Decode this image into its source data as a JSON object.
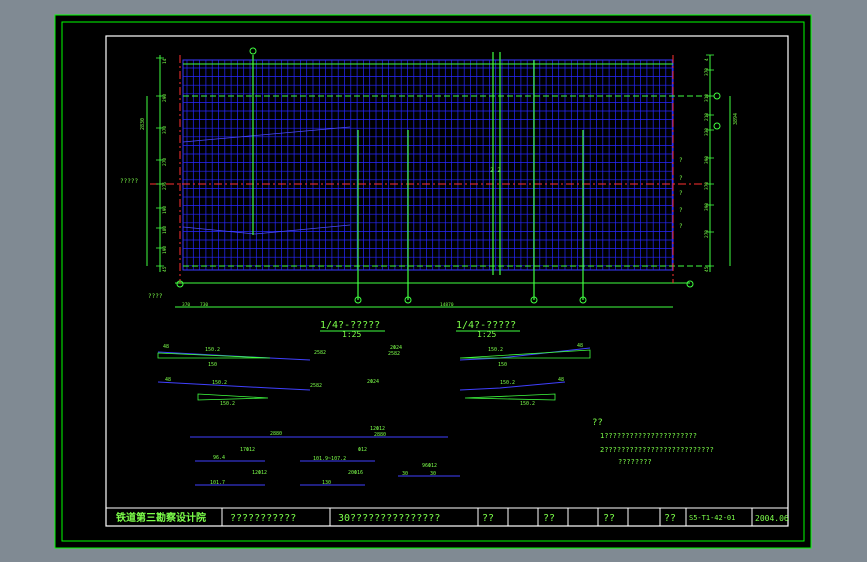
{
  "plan": {
    "left_label": "?????",
    "bottom_left_label": "????",
    "left_dims": [
      "14",
      "290",
      "370",
      "270",
      "276",
      "190",
      "180",
      "190",
      "45"
    ],
    "left_total": "2830",
    "right_dims": [
      "4",
      "370",
      "310",
      "210",
      "330",
      "390",
      "370",
      "390",
      "270",
      "45"
    ],
    "right_total": "3894",
    "right_qmarks": [
      "?",
      "?",
      "?",
      "?",
      "?"
    ],
    "bottom_dims": [
      "370",
      "730",
      "14870"
    ],
    "center_mark": "2 2"
  },
  "views": [
    {
      "title": "1/4?-?????",
      "scale": "1:25"
    },
    {
      "title": "1/4?-?????",
      "scale": "1:25"
    }
  ],
  "details": {
    "row1": {
      "left": "48",
      "a": "150.2",
      "b": "150",
      "mid": "2582",
      "tag": "2Ф24",
      "tag2": "2582",
      "ra": "150.2",
      "rb": "150",
      "right": "48"
    },
    "row2": {
      "left": "48",
      "a": "150.2",
      "b": "150.2",
      "mid": "2582",
      "tag": "2Ф24",
      "ra": "150.2",
      "rb": "150.2",
      "right": "48"
    },
    "row3": {
      "mid": "2880",
      "tag": "12Ф12",
      "tag2": "2880"
    },
    "row4": {
      "a": "96.4",
      "tag": "17Ф12",
      "b": "101.9~107.2",
      "tag2": "Ф12"
    },
    "row5": {
      "a": "101.7",
      "tag": "12Ф12",
      "b": "130",
      "tag2": "20Ф16",
      "c": "30",
      "tag3": "96Ф12",
      "d": "30"
    }
  },
  "notes": {
    "heading": "??",
    "lines": [
      "1??????????????????????",
      "2??????????????????????????",
      "????????"
    ]
  },
  "title_block": {
    "company": "铁道第三勘察设计院",
    "project": "???????????",
    "drawing": "30???????????????",
    "cells": [
      "??",
      "??",
      "??",
      "??"
    ],
    "drawing_no": "S5-T1-42-01",
    "date": "2004.06"
  },
  "colors": {
    "background": "#000000",
    "frame": "#00ff00",
    "grid": "#2020ff",
    "axis": "#ff3030",
    "text": "#7cff4a"
  }
}
